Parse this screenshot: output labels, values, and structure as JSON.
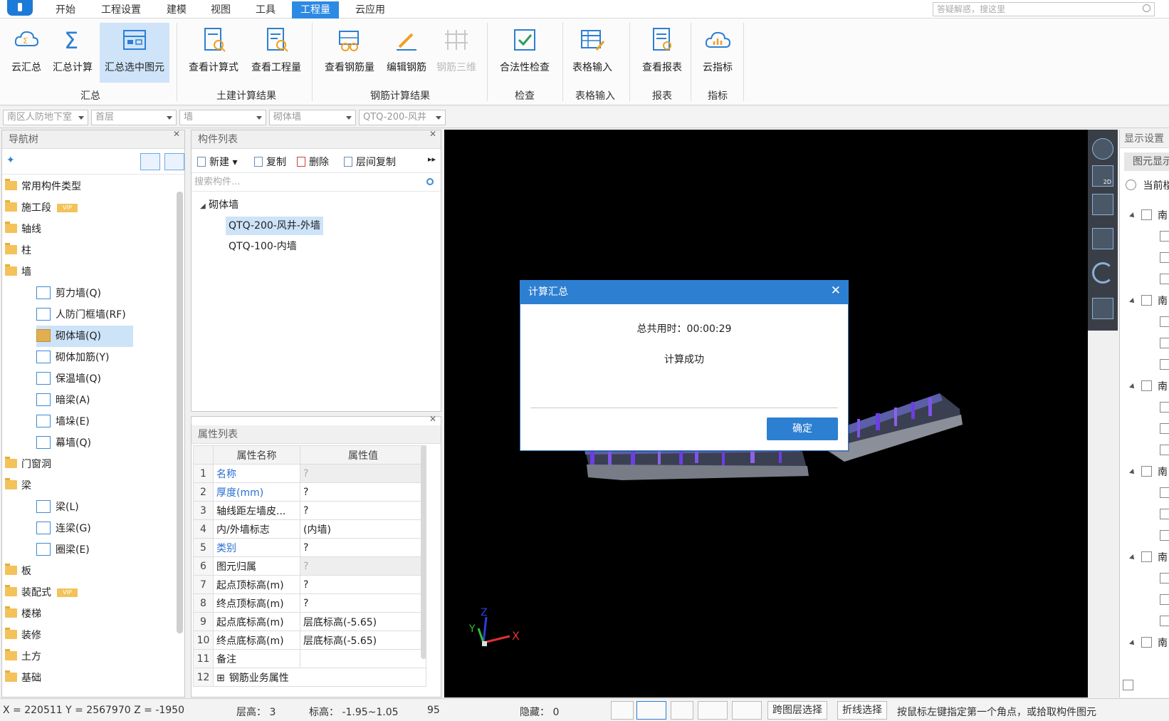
{
  "menu": {
    "tabs": [
      "开始",
      "工程设置",
      "建模",
      "视图",
      "工具",
      "工程量",
      "云应用"
    ],
    "active_tab": "工程量",
    "help_search_placeholder": "答疑解惑，搜这里"
  },
  "ribbon": {
    "groups": [
      {
        "label": "汇总",
        "buttons": [
          "云汇总",
          "汇总计算",
          "汇总选中图元"
        ]
      },
      {
        "label": "土建计算结果",
        "buttons": [
          "查看计算式",
          "查看工程量"
        ]
      },
      {
        "label": "钢筋计算结果",
        "buttons": [
          "查看钢筋量",
          "编辑钢筋",
          "钢筋三维"
        ]
      },
      {
        "label": "检查",
        "buttons": [
          "合法性检查"
        ]
      },
      {
        "label": "表格输入",
        "buttons": [
          "表格输入"
        ]
      },
      {
        "label": "报表",
        "buttons": [
          "查看报表"
        ]
      },
      {
        "label": "指标",
        "buttons": [
          "云指标"
        ]
      }
    ],
    "selected_button": "汇总选中图元",
    "disabled_button": "钢筋三维"
  },
  "filters": [
    "南区人防地下室",
    "首层",
    "墙",
    "砌体墙",
    "QTQ-200-风井"
  ],
  "nav_tree": {
    "title": "导航树",
    "items": [
      {
        "label": "常用构件类型",
        "type": "folder"
      },
      {
        "label": "施工段",
        "type": "folder",
        "badge": "VIP"
      },
      {
        "label": "轴线",
        "type": "folder"
      },
      {
        "label": "柱",
        "type": "folder"
      },
      {
        "label": "墙",
        "type": "folder-open"
      },
      {
        "label": "剪力墙(Q)",
        "type": "child"
      },
      {
        "label": "人防门框墙(RF)",
        "type": "child"
      },
      {
        "label": "砌体墙(Q)",
        "type": "child",
        "selected": true
      },
      {
        "label": "砌体加筋(Y)",
        "type": "child"
      },
      {
        "label": "保温墙(Q)",
        "type": "child"
      },
      {
        "label": "暗梁(A)",
        "type": "child"
      },
      {
        "label": "墙垛(E)",
        "type": "child"
      },
      {
        "label": "幕墙(Q)",
        "type": "child"
      },
      {
        "label": "门窗洞",
        "type": "folder"
      },
      {
        "label": "梁",
        "type": "folder-open"
      },
      {
        "label": "梁(L)",
        "type": "child"
      },
      {
        "label": "连梁(G)",
        "type": "child"
      },
      {
        "label": "圈梁(E)",
        "type": "child"
      },
      {
        "label": "板",
        "type": "folder"
      },
      {
        "label": "装配式",
        "type": "folder",
        "badge": "VIP"
      },
      {
        "label": "楼梯",
        "type": "folder"
      },
      {
        "label": "装修",
        "type": "folder"
      },
      {
        "label": "土方",
        "type": "folder"
      },
      {
        "label": "基础",
        "type": "folder"
      }
    ]
  },
  "component_list": {
    "title": "构件列表",
    "toolbar": [
      "新建",
      "复制",
      "删除",
      "层间复制"
    ],
    "search_placeholder": "搜索构件...",
    "group": "砌体墙",
    "items": [
      "QTQ-200-风井-外墙",
      "QTQ-100-内墙"
    ],
    "selected": "QTQ-200-风井-外墙"
  },
  "property_list": {
    "title": "属性列表",
    "headers": [
      "属性名称",
      "属性值"
    ],
    "rows": [
      {
        "idx": "1",
        "name": "名称",
        "value": "?",
        "blue": true,
        "shaded": true
      },
      {
        "idx": "2",
        "name": "厚度(mm)",
        "value": "?",
        "blue": true
      },
      {
        "idx": "3",
        "name": "轴线距左墙皮...",
        "value": "?"
      },
      {
        "idx": "4",
        "name": "内/外墙标志",
        "value": "(内墙)"
      },
      {
        "idx": "5",
        "name": "类别",
        "value": "?",
        "blue": true
      },
      {
        "idx": "6",
        "name": "图元归属",
        "value": "?",
        "shaded": true
      },
      {
        "idx": "7",
        "name": "起点顶标高(m)",
        "value": "?"
      },
      {
        "idx": "8",
        "name": "终点顶标高(m)",
        "value": "?"
      },
      {
        "idx": "9",
        "name": "起点底标高(m)",
        "value": "层底标高(-5.65)"
      },
      {
        "idx": "10",
        "name": "终点底标高(m)",
        "value": "层底标高(-5.65)"
      },
      {
        "idx": "11",
        "name": "备注",
        "value": ""
      },
      {
        "idx": "12",
        "name": "钢筋业务属性",
        "value": "",
        "expander": true
      }
    ]
  },
  "display_settings": {
    "title": "显示设置",
    "tab": "图元显示",
    "radio": "当前楼层",
    "group_label": "南"
  },
  "axes": {
    "x": "X",
    "y": "Y",
    "z": "Z"
  },
  "dialog": {
    "title": "计算汇总",
    "time_text": "总共用时：00:00:29",
    "message": "计算成功",
    "ok_label": "确定"
  },
  "status": {
    "coords": "X = 220511 Y = 2567970 Z = -1950",
    "floor_height": "层高：  3",
    "elevation": "标高：  -1.95~1.05",
    "number": "95",
    "hidden": "隐藏：  0",
    "btn_cross_layer": "跨图层选择",
    "btn_polyline": "折线选择",
    "hint": "按鼠标左键指定第一个角点，或拾取构件图元"
  },
  "colors": {
    "accent": "#2d7fd2",
    "menu_active": "#2d8ae3",
    "folder": "#f3c25a",
    "selection": "#cde3f8"
  }
}
